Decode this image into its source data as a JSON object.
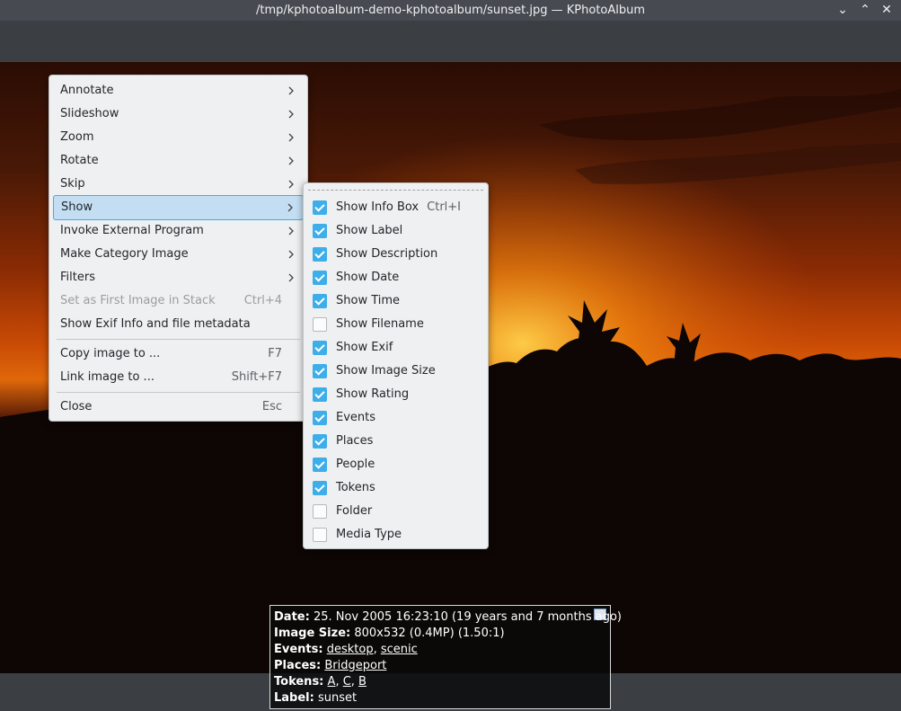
{
  "window": {
    "title": "/tmp/kphotoalbum-demo-kphotoalbum/sunset.jpg — KPhotoAlbum",
    "controls": {
      "minimize": "⌄",
      "maximize": "⌃",
      "close": "✕"
    }
  },
  "main_menu": {
    "items": [
      {
        "label": "Annotate",
        "submenu": true
      },
      {
        "label": "Slideshow",
        "submenu": true
      },
      {
        "label": "Zoom",
        "submenu": true
      },
      {
        "label": "Rotate",
        "submenu": true
      },
      {
        "label": "Skip",
        "submenu": true
      },
      {
        "label": "Show",
        "submenu": true,
        "active": true
      },
      {
        "label": "Invoke External Program",
        "submenu": true
      },
      {
        "label": "Make Category Image",
        "submenu": true
      },
      {
        "label": "Filters",
        "submenu": true
      },
      {
        "label": "Set as First Image in Stack",
        "shortcut": "Ctrl+4",
        "disabled": true
      },
      {
        "label": "Show Exif Info and file metadata"
      },
      {
        "label": "Copy image to ...",
        "shortcut": "F7"
      },
      {
        "label": "Link image to ...",
        "shortcut": "Shift+F7"
      },
      {
        "label": "Close",
        "shortcut": "Esc"
      }
    ]
  },
  "show_menu": {
    "items": [
      {
        "label": "Show Info Box",
        "shortcut": "Ctrl+I",
        "checked": true
      },
      {
        "label": "Show Label",
        "checked": true
      },
      {
        "label": "Show Description",
        "checked": true
      },
      {
        "label": "Show Date",
        "checked": true
      },
      {
        "label": "Show Time",
        "checked": true
      },
      {
        "label": "Show Filename",
        "checked": false
      },
      {
        "label": "Show Exif",
        "checked": true
      },
      {
        "label": "Show Image Size",
        "checked": true
      },
      {
        "label": "Show Rating",
        "checked": true
      },
      {
        "label": "Events",
        "checked": true
      },
      {
        "label": "Places",
        "checked": true
      },
      {
        "label": "People",
        "checked": true
      },
      {
        "label": "Tokens",
        "checked": true
      },
      {
        "label": "Folder",
        "checked": false
      },
      {
        "label": "Media Type",
        "checked": false
      }
    ]
  },
  "info_box": {
    "date_label": "Date:",
    "date_value": "25. Nov 2005 16:23:10 (19 years and 7 months ago)",
    "size_label": "Image Size:",
    "size_value": "800x532 (0.4MP) (1.50:1)",
    "events_label": "Events:",
    "events": [
      "desktop",
      "scenic"
    ],
    "places_label": "Places:",
    "places": [
      "Bridgeport"
    ],
    "tokens_label": "Tokens:",
    "tokens": [
      "A",
      "C",
      "B"
    ],
    "label_label": "Label:",
    "label_value": "sunset"
  },
  "colors": {
    "accent": "#3daee9",
    "active_item_bg": "#c3def2",
    "menu_bg": "#eff0f1",
    "titlebar": "#474b51"
  }
}
